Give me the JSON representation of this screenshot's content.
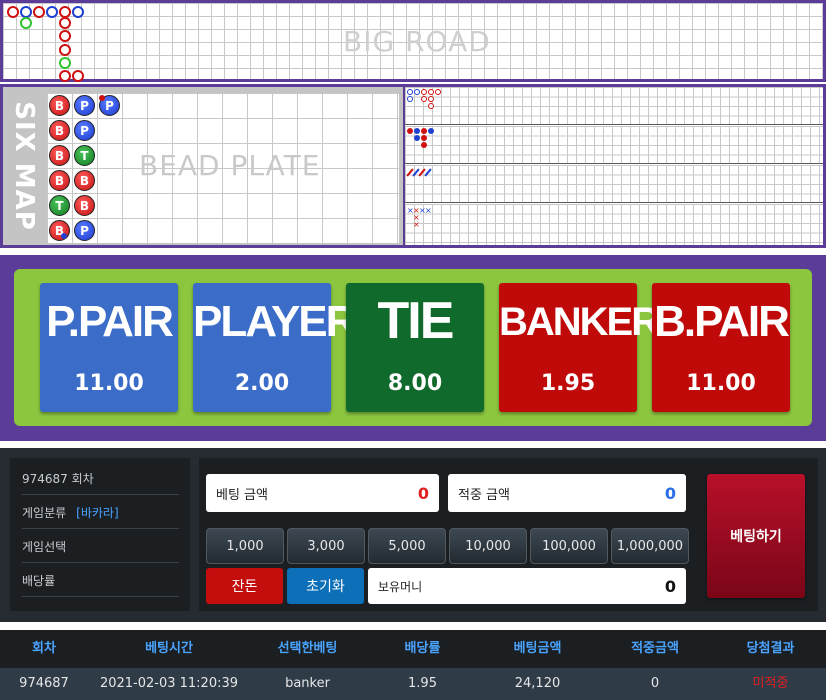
{
  "big_road": {
    "watermark": "BIG ROAD",
    "entries": [
      "banker",
      "player",
      "banker",
      "player",
      "banker",
      "player",
      "tie",
      "banker",
      "banker",
      "banker",
      "tie",
      "banker",
      "banker"
    ]
  },
  "six_map": {
    "label": "SIX MAP",
    "watermark": "BEAD PLATE",
    "beads": [
      {
        "result": "B",
        "label": "B"
      },
      {
        "result": "P",
        "label": "P"
      },
      {
        "result": "P",
        "label": "P"
      },
      {
        "result": "B",
        "label": "B"
      },
      {
        "result": "P",
        "label": "P"
      },
      {
        "result": "B",
        "label": "B"
      },
      {
        "result": "T",
        "label": "T"
      },
      {
        "result": "B",
        "label": "B"
      },
      {
        "result": "B",
        "label": "B"
      },
      {
        "result": "T",
        "label": "T"
      },
      {
        "result": "B",
        "label": "B"
      },
      {
        "result": "B",
        "label": "B"
      },
      {
        "result": "P",
        "label": "P"
      }
    ]
  },
  "bet_options": [
    {
      "label": "P.PAIR",
      "odds": "11.00",
      "color": "#3a6cc8"
    },
    {
      "label": "PLAYER",
      "odds": "2.00",
      "color": "#3a6cc8"
    },
    {
      "label": "TIE",
      "odds": "8.00",
      "color": "#0f6a2b"
    },
    {
      "label": "BANKER",
      "odds": "1.95",
      "color": "#c00a0a"
    },
    {
      "label": "B.PAIR",
      "odds": "11.00",
      "color": "#c00a0a"
    }
  ],
  "info": {
    "round": "974687 회차",
    "game_type_label": "게임분류",
    "game_type_value": "[바카라]",
    "game_select_label": "게임선택",
    "odds_label": "배당률"
  },
  "bet_panel": {
    "bet_amount_label": "베팅 금액",
    "bet_amount_value": "0",
    "win_amount_label": "적중 금액",
    "win_amount_value": "0",
    "chips": [
      "1,000",
      "3,000",
      "5,000",
      "10,000",
      "100,000",
      "1,000,000"
    ],
    "remainder_label": "잔돈",
    "reset_label": "초기화",
    "balance_label": "보유머니",
    "balance_value": "0",
    "bet_button": "베팅하기"
  },
  "history": {
    "headers": [
      "회차",
      "베팅시간",
      "선택한베팅",
      "배당률",
      "베팅금액",
      "적중금액",
      "당첨결과"
    ],
    "rows": [
      [
        "974687",
        "2021-02-03 11:20:39",
        "banker",
        "1.95",
        "24,120",
        "0",
        "미적중"
      ]
    ]
  },
  "colors": {
    "purple_frame": "#5b3d99",
    "green_board": "#8cc63f",
    "head_blue": "#4aa3ff",
    "lost_red": "#e02020"
  }
}
